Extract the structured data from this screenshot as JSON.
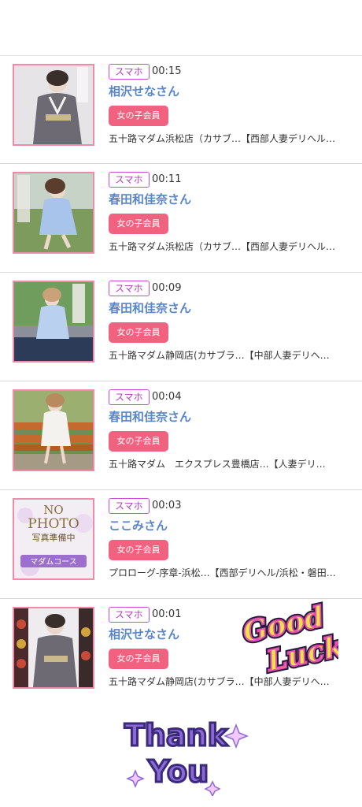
{
  "colors": {
    "accent_pink": "#f0627f",
    "name_blue": "#5b86c9",
    "badge_purple": "#c94bd3",
    "thumb_border": "#f08aa9"
  },
  "rows": [
    {
      "device": "スマホ",
      "time": "00:15",
      "name": "相沢せなさん",
      "member": "女の子会員",
      "shop": "五十路マダム浜松店（カサブ…【西部人妻デリヘル…",
      "thumb": "kimono"
    },
    {
      "device": "スマホ",
      "time": "00:11",
      "name": "春田和佳奈さん",
      "member": "女の子会員",
      "shop": "五十路マダム浜松店（カサブ…【西部人妻デリヘル…",
      "thumb": "blue-dress-lawn"
    },
    {
      "device": "スマホ",
      "time": "00:09",
      "name": "春田和佳奈さん",
      "member": "女の子会員",
      "shop": "五十路マダム静岡店(カサブラ…【中部人妻デリヘ…",
      "thumb": "blue-dress-pool"
    },
    {
      "device": "スマホ",
      "time": "00:04",
      "name": "春田和佳奈さん",
      "member": "女の子会員",
      "shop": "五十路マダム　エクスプレス豊橋店…【人妻デリ…",
      "thumb": "bench"
    },
    {
      "device": "スマホ",
      "time": "00:03",
      "name": "ここみさん",
      "member": "女の子会員",
      "shop": "プロローグ-序章-浜松…【西部デリヘル/浜松・磐田…",
      "thumb": "no-photo"
    },
    {
      "device": "スマホ",
      "time": "00:01",
      "name": "相沢せなさん",
      "member": "女の子会員",
      "shop": "五十路マダム静岡店(カサブラ…【中部人妻デリヘ…",
      "thumb": "kimono-2"
    }
  ],
  "thumb_texts": {
    "no_photo_line1": "NO",
    "no_photo_line2": "PHOTO",
    "no_photo_line3": "写真準備中",
    "no_photo_banner": "マダムコース"
  },
  "stickers": {
    "good_luck_line1": "Good",
    "good_luck_line2": "Luck",
    "thank_you_line1": "Thank",
    "thank_you_line2": "You"
  }
}
